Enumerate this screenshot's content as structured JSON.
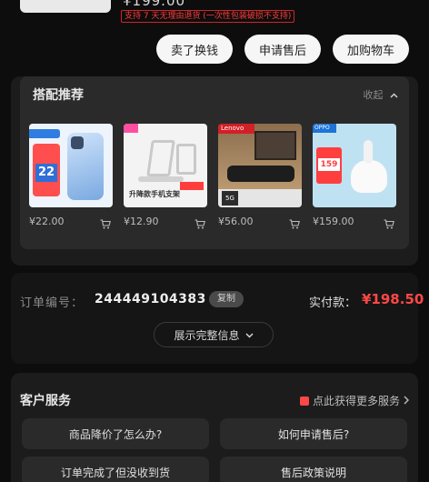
{
  "header": {
    "price": "¥199.00",
    "return_policy": "支持 7 天无理由退货 (一次性包装破损不支持)",
    "buttons": {
      "trade_in": "卖了换钱",
      "after_sale": "申请售后",
      "add_cart": "加购物车"
    }
  },
  "recommend": {
    "title": "搭配推荐",
    "collapse": "收起",
    "items": [
      {
        "price": "¥22.00",
        "tag": "22",
        "icon": "phone-case-image"
      },
      {
        "price": "¥12.90",
        "tag": "升降款手机支架",
        "icon": "phone-stand-image"
      },
      {
        "price": "¥56.00",
        "tag": "Lenovo",
        "icon": "speaker-image"
      },
      {
        "price": "¥159.00",
        "tag": "159",
        "icon": "earbuds-image"
      }
    ]
  },
  "order": {
    "number_label": "订单编号：",
    "number": "244449104383",
    "copy": "复制",
    "paid_label": "实付款：",
    "paid_amount": "¥198.50",
    "expand": "展示完整信息"
  },
  "service": {
    "title": "客户服务",
    "more": "点此获得更多服务",
    "questions": [
      "商品降价了怎么办?",
      "如何申请售后?",
      "订单完成了但没收到货",
      "售后政策说明"
    ]
  },
  "colors": {
    "accent": "#ff4747",
    "background": "#0d0d0d",
    "panel": "#1c1c1c"
  }
}
